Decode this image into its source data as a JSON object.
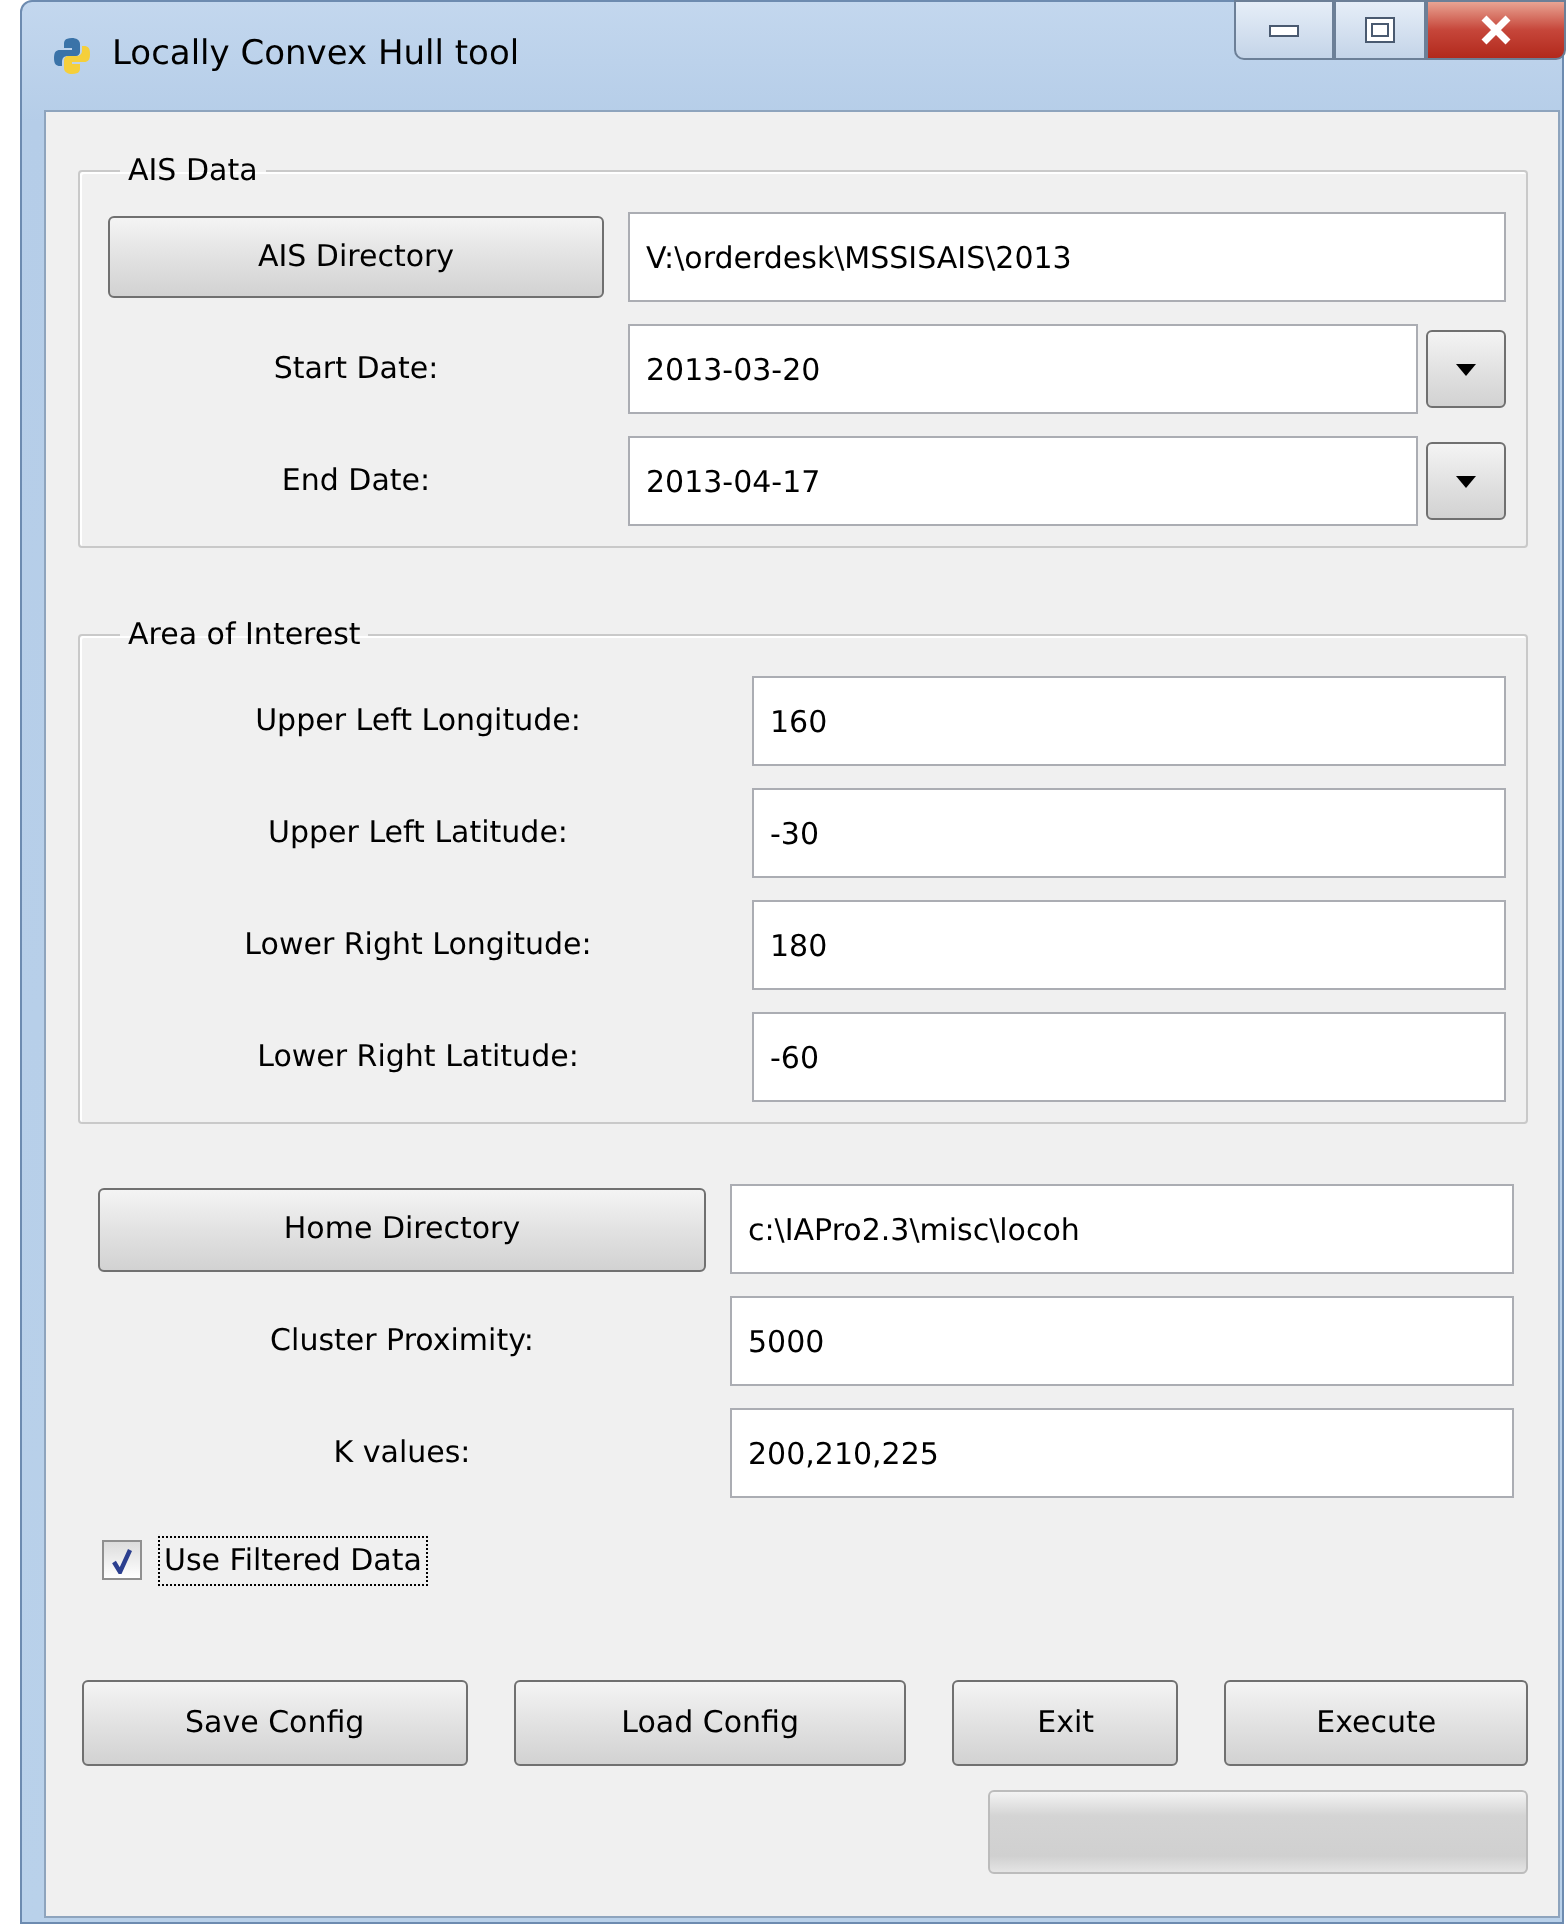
{
  "window": {
    "title": "Locally Convex Hull tool"
  },
  "ais_data": {
    "title": "AIS Data",
    "directory_button": "AIS Directory",
    "directory": "V:\\orderdesk\\MSSISAIS\\2013",
    "dates": [
      {
        "label": "Start Date:",
        "value": "2013-03-20"
      },
      {
        "label": "End Date:",
        "value": "2013-04-17"
      }
    ]
  },
  "area_of_interest": {
    "title": "Area of Interest",
    "fields": [
      {
        "label": "Upper Left Longitude:",
        "value": "160"
      },
      {
        "label": "Upper Left Latitude:",
        "value": "-30"
      },
      {
        "label": "Lower Right Longitude:",
        "value": "180"
      },
      {
        "label": "Lower Right Latitude:",
        "value": "-60"
      }
    ]
  },
  "home_directory_button": "Home Directory",
  "home_directory": "c:\\IAPro2.3\\misc\\locoh",
  "settings": [
    {
      "label": "Cluster Proximity:",
      "value": "5000"
    },
    {
      "label": "K values:",
      "value": "200,210,225"
    }
  ],
  "use_filtered_data": {
    "label": "Use Filtered Data",
    "checked": true
  },
  "buttons": [
    "Save Config",
    "Load Config",
    "Exit",
    "Execute"
  ],
  "progress": {
    "level": 0
  }
}
